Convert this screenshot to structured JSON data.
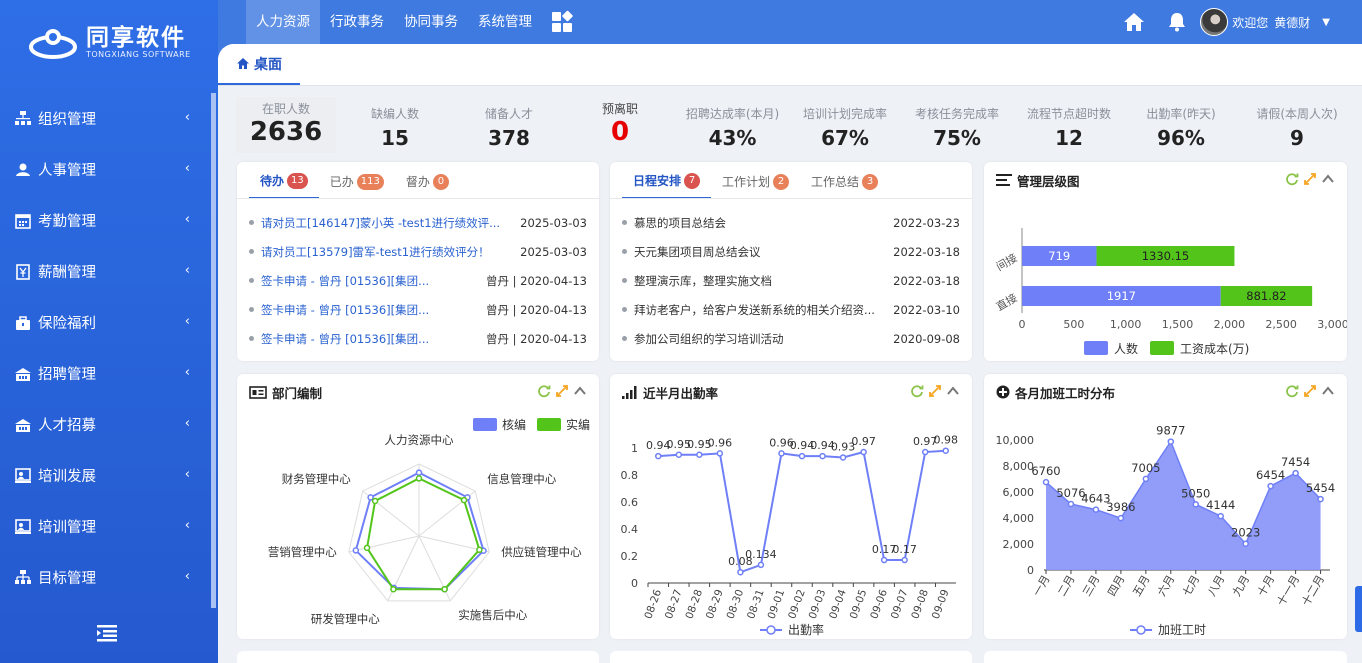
{
  "sidebar": {
    "logo_title": "同享软件",
    "logo_sub": "TONGXIANG SOFTWARE",
    "items": [
      {
        "label": "组织管理",
        "icon": "org-chart-icon"
      },
      {
        "label": "人事管理",
        "icon": "users-icon"
      },
      {
        "label": "考勤管理",
        "icon": "calendar-icon"
      },
      {
        "label": "薪酬管理",
        "icon": "salary-icon"
      },
      {
        "label": "保险福利",
        "icon": "briefcase-icon"
      },
      {
        "label": "招聘管理",
        "icon": "building-icon"
      },
      {
        "label": "人才招募",
        "icon": "building-icon"
      },
      {
        "label": "培训发展",
        "icon": "training-icon"
      },
      {
        "label": "培训管理",
        "icon": "training-icon"
      },
      {
        "label": "目标管理",
        "icon": "sitemap-icon"
      }
    ]
  },
  "topnav": {
    "items": [
      "人力资源",
      "行政事务",
      "协同事务",
      "系统管理"
    ],
    "active": 0,
    "welcome": "欢迎您",
    "user": "黄德财"
  },
  "tab": {
    "label": "桌面"
  },
  "kpis": [
    {
      "label": "在职人数",
      "value": "2636"
    },
    {
      "label": "缺编人数",
      "value": "15"
    },
    {
      "label": "储备人才",
      "value": "378"
    },
    {
      "label": "预离职",
      "value": "0"
    },
    {
      "label": "招聘达成率(本月)",
      "value": "43%"
    },
    {
      "label": "培训计划完成率",
      "value": "67%"
    },
    {
      "label": "考核任务完成率",
      "value": "75%"
    },
    {
      "label": "流程节点超时数",
      "value": "12"
    },
    {
      "label": "出勤率(昨天)",
      "value": "96%"
    },
    {
      "label": "请假(本周人次)",
      "value": "9"
    }
  ],
  "todo": {
    "tabs": [
      {
        "label": "待办",
        "count": "13"
      },
      {
        "label": "已办",
        "count": "113"
      },
      {
        "label": "督办",
        "count": "0"
      }
    ],
    "items": [
      {
        "text": "请对员工[146147]蒙小英 -test1进行绩效评...",
        "date": "2025-03-03"
      },
      {
        "text": "请对员工[13579]雷军-test1进行绩效评分！",
        "date": "2025-03-03"
      },
      {
        "text": "签卡申请 - 曾丹 [01536][集团...",
        "date": "曾丹 | 2020-04-13"
      },
      {
        "text": "签卡申请 - 曾丹 [01536][集团...",
        "date": "曾丹 | 2020-04-13"
      },
      {
        "text": "签卡申请 - 曾丹 [01536][集团...",
        "date": "曾丹 | 2020-04-13"
      }
    ]
  },
  "schedule": {
    "tabs": [
      {
        "label": "日程安排",
        "count": "7"
      },
      {
        "label": "工作计划",
        "count": "2"
      },
      {
        "label": "工作总结",
        "count": "3"
      }
    ],
    "items": [
      {
        "text": "慕思的项目总结会",
        "date": "2022-03-23"
      },
      {
        "text": "天元集团项目周总结会议",
        "date": "2022-03-18"
      },
      {
        "text": "整理演示库，整理实施文档",
        "date": "2022-03-18"
      },
      {
        "text": "拜访老客户，给客户发送新系统的相关介绍资...",
        "date": "2022-03-10"
      },
      {
        "text": "参加公司组织的学习培训活动",
        "date": "2020-09-08"
      }
    ]
  },
  "panels": {
    "hierarchy": "管理层级图",
    "dept": "部门编制",
    "attendance": "近半月出勤率",
    "overtime": "各月加班工时分布"
  },
  "colors": {
    "accent": "#2f68d8",
    "blue_series": "#6f7ff7",
    "green_series": "#52c41a",
    "red": "#e60000"
  },
  "chart_data": [
    {
      "type": "bar",
      "orientation": "horizontal",
      "stacked": true,
      "categories": [
        "间接",
        "直接"
      ],
      "series": [
        {
          "name": "人数",
          "values": [
            719,
            1917
          ]
        },
        {
          "name": "工资成本(万)",
          "values": [
            1330.15,
            881.82
          ]
        }
      ],
      "xlim": [
        0,
        3000
      ],
      "xticks": [
        "0",
        "500",
        "1,000",
        "1,500",
        "2,000",
        "2,500",
        "3,000"
      ],
      "legend": "bottom"
    },
    {
      "type": "radar",
      "indicators": [
        "人力资源中心",
        "信息管理中心",
        "供应链管理中心",
        "实施售后中心",
        "研发管理中心",
        "营销管理中心",
        "财务管理中心"
      ],
      "series": [
        {
          "name": "核编",
          "values": [
            0.88,
            0.86,
            0.92,
            0.82,
            0.8,
            0.9,
            0.86
          ]
        },
        {
          "name": "实编",
          "values": [
            0.8,
            0.8,
            0.86,
            0.82,
            0.82,
            0.74,
            0.78
          ]
        }
      ],
      "legend": "top-right"
    },
    {
      "type": "line",
      "x": [
        "08-26",
        "08-27",
        "08-28",
        "08-29",
        "08-30",
        "08-31",
        "09-01",
        "09-02",
        "09-03",
        "09-04",
        "09-05",
        "09-06",
        "09-07",
        "09-08",
        "09-09"
      ],
      "series": [
        {
          "name": "出勤率",
          "values": [
            0.94,
            0.95,
            0.95,
            0.96,
            0.08,
            0.134,
            0.96,
            0.94,
            0.94,
            0.93,
            0.97,
            0.17,
            0.17,
            0.97,
            0.98
          ]
        }
      ],
      "labels": [
        "0.94",
        "0.95",
        "0.95",
        "0.96",
        "0.08",
        "0.134",
        "0.96",
        "0.94",
        "0.94",
        "0.93",
        "0.97",
        "0.17",
        "0.17",
        "0.97",
        "0.98"
      ],
      "ylim": [
        0,
        1
      ],
      "yticks": [
        "0",
        "0.2",
        "0.4",
        "0.6",
        "0.8",
        "1"
      ],
      "legend": "bottom"
    },
    {
      "type": "area",
      "x": [
        "一月",
        "二月",
        "三月",
        "四月",
        "五月",
        "六月",
        "七月",
        "八月",
        "九月",
        "十月",
        "十一月",
        "十二月"
      ],
      "series": [
        {
          "name": "加班工时",
          "values": [
            6760,
            5076,
            4643,
            3986,
            7005,
            9877,
            5050,
            4144,
            2023,
            6454,
            7454,
            5454
          ]
        }
      ],
      "ylim": [
        0,
        10000
      ],
      "yticks": [
        "0",
        "2,000",
        "4,000",
        "6,000",
        "8,000",
        "10,000"
      ],
      "legend": "bottom"
    }
  ]
}
